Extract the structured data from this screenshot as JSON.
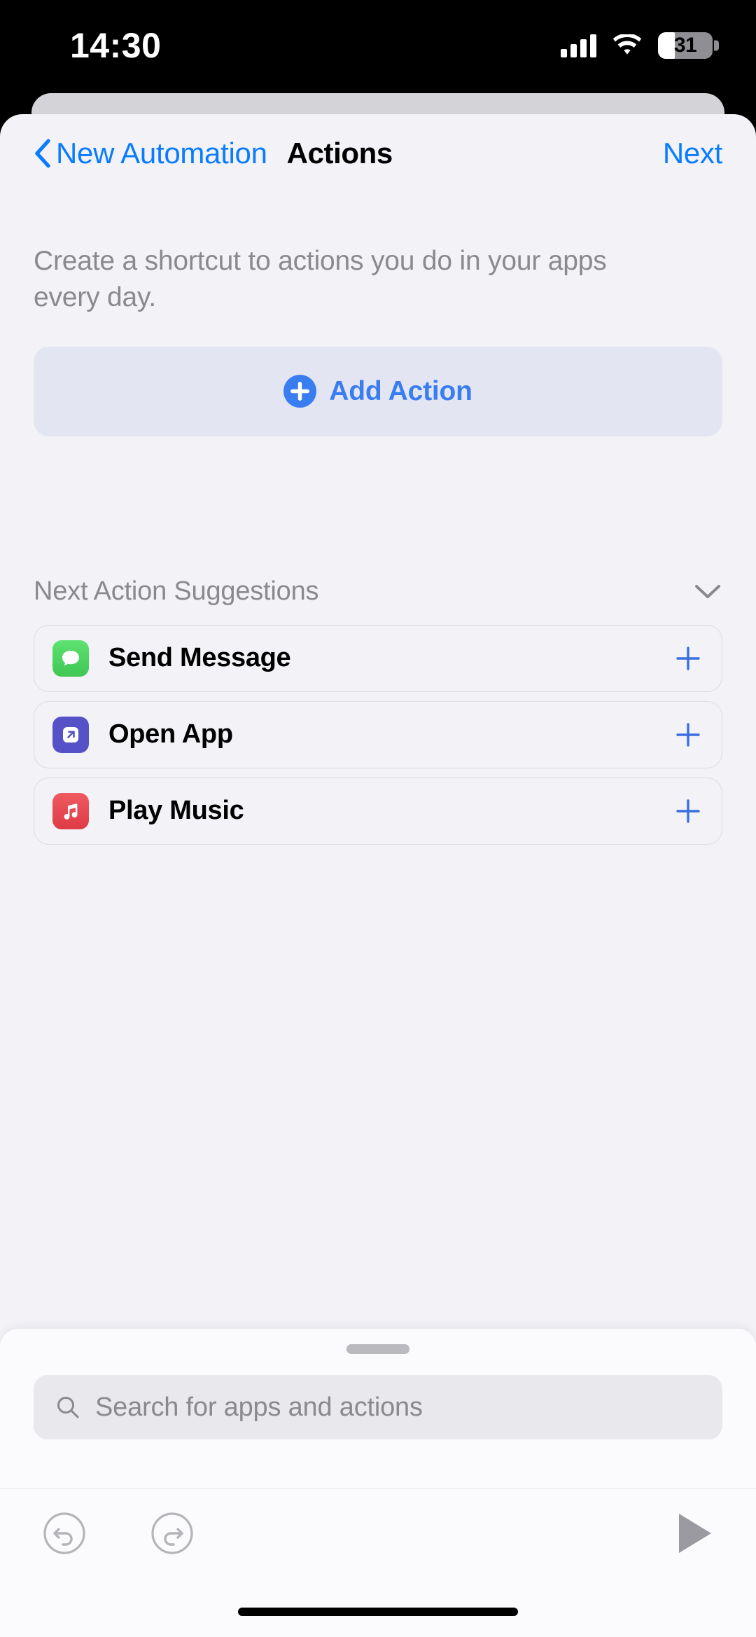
{
  "status_bar": {
    "time": "14:30",
    "battery_percent": "31",
    "battery_level": 31,
    "signal_icon": "cellular-signal-icon",
    "wifi_icon": "wifi-icon",
    "battery_icon": "battery-icon"
  },
  "nav": {
    "back_label": "New Automation",
    "back_icon": "chevron-left-icon",
    "title": "Actions",
    "next_label": "Next"
  },
  "main": {
    "description": "Create a shortcut to actions you do in your apps every day.",
    "add_action": {
      "label": "Add Action",
      "icon": "plus-circle-icon",
      "accent": "#3a7df1",
      "background": "#e3e5f2"
    },
    "suggestions": {
      "header": "Next Action Suggestions",
      "collapse_icon": "chevron-down-icon",
      "items": [
        {
          "label": "Send Message",
          "icon": "messages-app-icon",
          "icon_color": "#4cd363",
          "add_icon": "plus-icon"
        },
        {
          "label": "Open App",
          "icon": "open-app-icon",
          "icon_color": "#5552c8",
          "add_icon": "plus-icon"
        },
        {
          "label": "Play Music",
          "icon": "music-app-icon",
          "icon_color": "#e84a52",
          "add_icon": "plus-icon"
        }
      ]
    }
  },
  "bottom_sheet": {
    "grabber": "sheet-grabber",
    "search": {
      "placeholder": "Search for apps and actions",
      "value": "",
      "icon": "search-icon"
    }
  },
  "toolbar": {
    "undo_icon": "undo-icon",
    "redo_icon": "redo-icon",
    "play_icon": "play-icon"
  },
  "colors": {
    "accent_blue": "#0a7cff",
    "page_background": "#f2f2f7",
    "sheet_background": "#fbfbfd"
  }
}
